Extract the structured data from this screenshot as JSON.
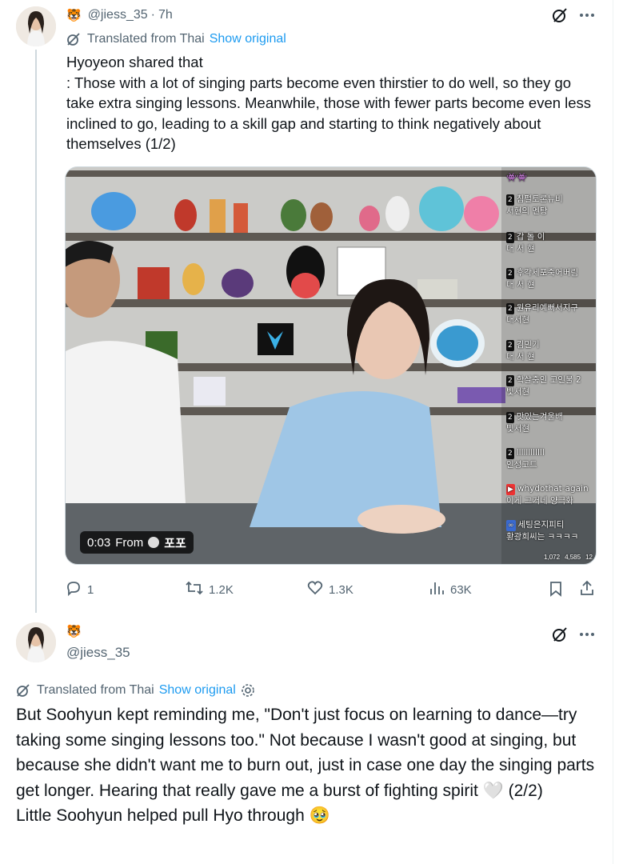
{
  "tweet1": {
    "emoji": "🐯",
    "handle": "@jiess_35",
    "separator": "·",
    "time": "7h",
    "translated_label": "Translated from Thai",
    "show_original": "Show original",
    "text": "Hyoyeon shared that\n: Those with a lot of singing parts become even thirstier to do well, so they go take extra singing lessons. Meanwhile, those with fewer parts become even less inclined to go, leading to a skill gap and starting to think negatively about themselves (1/2)",
    "video": {
      "timestamp": "0:03",
      "from_label": "From",
      "source_name": "포포",
      "chat": [
        {
          "badge": "2",
          "name": "침펄토론뉴비",
          "msg": "서현의 멘탕"
        },
        {
          "badge": "2",
          "name": "갑 돌 이",
          "msg": "대 서 현"
        },
        {
          "badge": "2",
          "name": "후각세포죽어버림",
          "msg": "대 서 현"
        },
        {
          "badge": "2",
          "name": "원유리예뻐서지구",
          "msg": "대서현"
        },
        {
          "badge": "2",
          "name": "김민기",
          "msg": "대 서 현"
        },
        {
          "badge": "2",
          "name": "학살중인 고인물 2",
          "msg": "빛서현"
        },
        {
          "badge": "2",
          "name": "맛있는겨울배",
          "msg": "빛서현"
        },
        {
          "badge": "2",
          "name": "llllllllllll",
          "msg": "인성고트"
        },
        {
          "badge": "▶",
          "name": "whydothat-again",
          "msg": "이게 그거네 양극화"
        },
        {
          "badge": "∞",
          "name": "세팅은지피티",
          "msg": "황광희씨는 ㅋㅋㅋㅋ"
        }
      ],
      "stats": [
        "1,072",
        "4,585",
        "12"
      ]
    },
    "actions": {
      "replies": "1",
      "reposts": "1.2K",
      "likes": "1.3K",
      "views": "63K"
    }
  },
  "tweet2": {
    "emoji": "🐯",
    "handle": "@jiess_35",
    "translated_label": "Translated from Thai",
    "show_original": "Show original",
    "text": "But Soohyun kept reminding me, \"Don't just focus on learning to dance—try taking some singing lessons too.\" Not because I wasn't good at singing, but because she didn't want me to burn out, just in case one day the singing parts get longer. Hearing that really gave me a burst of fighting spirit 🤍 (2/2)\nLittle Soohyun helped pull Hyo through 🥹"
  },
  "colors": {
    "link": "#1d9bf0",
    "muted": "#536471",
    "text": "#0f1419",
    "divider": "#cfd9de"
  },
  "icons": [
    "grok-icon",
    "more-icon",
    "translate-icon",
    "reply-icon",
    "repost-icon",
    "like-icon",
    "views-icon",
    "bookmark-icon",
    "share-icon",
    "gear-icon"
  ]
}
